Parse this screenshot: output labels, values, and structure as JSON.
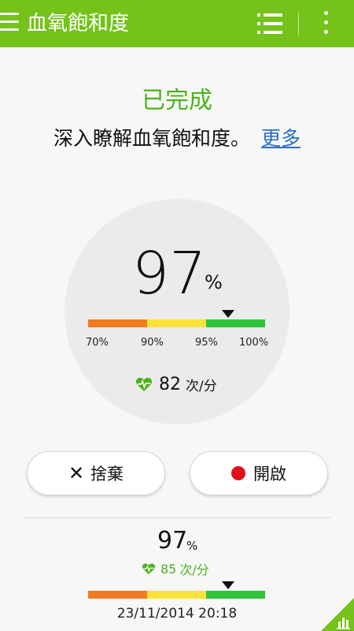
{
  "app": {
    "title": "血氧飽和度"
  },
  "status": {
    "title": "已完成",
    "info_text": "深入瞭解血氧飽和度。",
    "more_link": "更多"
  },
  "measurement": {
    "value": "97",
    "unit": "%",
    "scale_ticks": [
      "70%",
      "90%",
      "95%",
      "100%"
    ],
    "heart_rate": "82",
    "heart_rate_unit": "次/分"
  },
  "buttons": {
    "discard_label": "捨棄",
    "start_label": "開啟"
  },
  "last_record": {
    "value": "97",
    "unit": "%",
    "heart_rate": "85",
    "heart_rate_unit": "次/分",
    "timestamp": "23/11/2014 20:18"
  },
  "colors": {
    "accent": "#74c21a",
    "status_green": "#4bb31c",
    "scale_orange": "#f07b22",
    "scale_yellow": "#fbe23a",
    "scale_green": "#2fc43c",
    "record_red": "#e0101a",
    "link_blue": "#2a6fc9"
  },
  "icons": [
    "menu-icon",
    "list-icon",
    "more-vert-icon",
    "heart-rate-icon",
    "close-icon",
    "record-icon",
    "chart-icon"
  ]
}
